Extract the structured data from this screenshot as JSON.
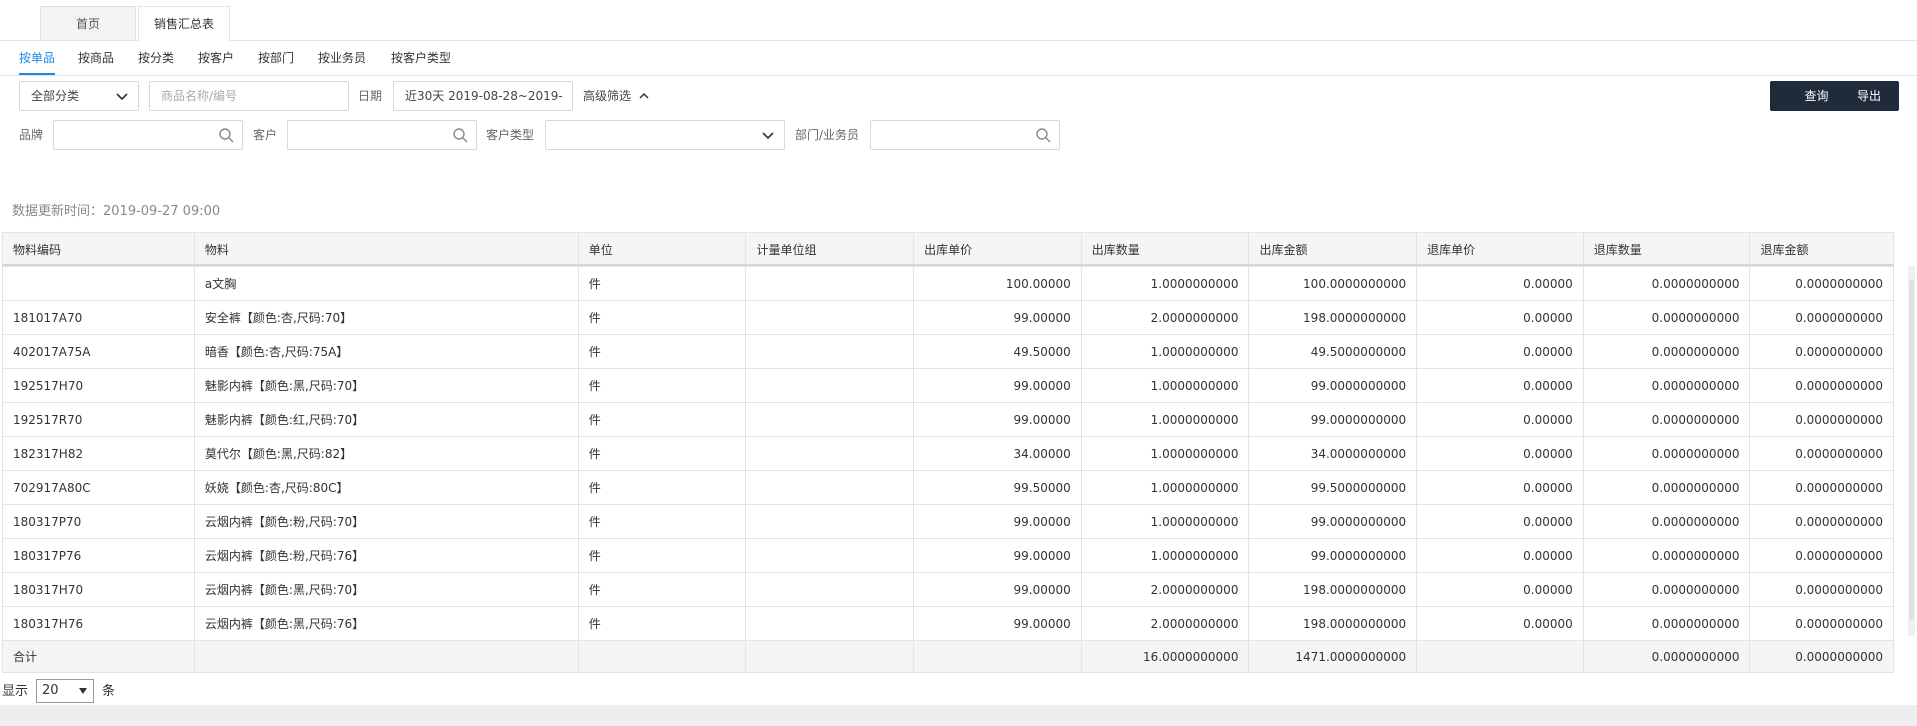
{
  "page_tabs": [
    {
      "label": "首页"
    },
    {
      "label": "销售汇总表"
    }
  ],
  "sub_tabs": [
    "按单品",
    "按商品",
    "按分类",
    "按客户",
    "按部门",
    "按业务员",
    "按客户类型"
  ],
  "filters": {
    "category_value": "全部分类",
    "product_placeholder": "商品名称/编号",
    "date_label": "日期",
    "date_value": "近30天   2019-08-28~2019-",
    "advanced_label": "高级筛选",
    "brand_label": "品牌",
    "customer_label": "客户",
    "customer_type_label": "客户类型",
    "dept_label": "部门/业务员"
  },
  "buttons": {
    "query": "查询",
    "export": "导出"
  },
  "updated_text": "数据更新时间：2019-09-27 09:00",
  "table": {
    "columns": [
      "物料编码",
      "物料",
      "单位",
      "计量单位组",
      "出库单价",
      "出库数量",
      "出库金额",
      "退库单价",
      "退库数量",
      "退库金额"
    ],
    "rows": [
      [
        "",
        "a文胸",
        "件",
        "",
        "100.00000",
        "1.0000000000",
        "100.0000000000",
        "0.00000",
        "0.0000000000",
        "0.0000000000"
      ],
      [
        "181017A70",
        "安全裤【颜色:杏,尺码:70】",
        "件",
        "",
        "99.00000",
        "2.0000000000",
        "198.0000000000",
        "0.00000",
        "0.0000000000",
        "0.0000000000"
      ],
      [
        "402017A75A",
        "暗香【颜色:杏,尺码:75A】",
        "件",
        "",
        "49.50000",
        "1.0000000000",
        "49.5000000000",
        "0.00000",
        "0.0000000000",
        "0.0000000000"
      ],
      [
        "192517H70",
        "魅影内裤【颜色:黑,尺码:70】",
        "件",
        "",
        "99.00000",
        "1.0000000000",
        "99.0000000000",
        "0.00000",
        "0.0000000000",
        "0.0000000000"
      ],
      [
        "192517R70",
        "魅影内裤【颜色:红,尺码:70】",
        "件",
        "",
        "99.00000",
        "1.0000000000",
        "99.0000000000",
        "0.00000",
        "0.0000000000",
        "0.0000000000"
      ],
      [
        "182317H82",
        "莫代尔【颜色:黑,尺码:82】",
        "件",
        "",
        "34.00000",
        "1.0000000000",
        "34.0000000000",
        "0.00000",
        "0.0000000000",
        "0.0000000000"
      ],
      [
        "702917A80C",
        "妖娆【颜色:杏,尺码:80C】",
        "件",
        "",
        "99.50000",
        "1.0000000000",
        "99.5000000000",
        "0.00000",
        "0.0000000000",
        "0.0000000000"
      ],
      [
        "180317P70",
        "云烟内裤【颜色:粉,尺码:70】",
        "件",
        "",
        "99.00000",
        "1.0000000000",
        "99.0000000000",
        "0.00000",
        "0.0000000000",
        "0.0000000000"
      ],
      [
        "180317P76",
        "云烟内裤【颜色:粉,尺码:76】",
        "件",
        "",
        "99.00000",
        "1.0000000000",
        "99.0000000000",
        "0.00000",
        "0.0000000000",
        "0.0000000000"
      ],
      [
        "180317H70",
        "云烟内裤【颜色:黑,尺码:70】",
        "件",
        "",
        "99.00000",
        "2.0000000000",
        "198.0000000000",
        "0.00000",
        "0.0000000000",
        "0.0000000000"
      ],
      [
        "180317H76",
        "云烟内裤【颜色:黑,尺码:76】",
        "件",
        "",
        "99.00000",
        "2.0000000000",
        "198.0000000000",
        "0.00000",
        "0.0000000000",
        "0.0000000000"
      ]
    ],
    "total_row": [
      "合计",
      "",
      "",
      "",
      "",
      "16.0000000000",
      "1471.0000000000",
      "",
      "0.0000000000",
      "0.0000000000"
    ]
  },
  "pager": {
    "prefix": "显示",
    "page_size": "20",
    "suffix": "条"
  }
}
